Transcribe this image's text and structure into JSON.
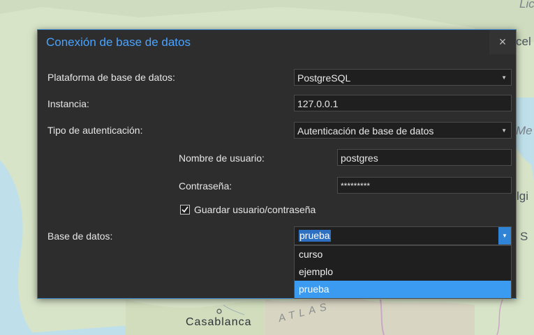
{
  "map": {
    "labels": {
      "top_right": "Lic",
      "right_1": "cel",
      "right_2": "Me",
      "right_3": "lgi",
      "right_4": "S",
      "city": "Casablanca",
      "range": "ATLAS"
    }
  },
  "dialog": {
    "title": "Conexión de base de datos",
    "close_icon": "×",
    "platform": {
      "label": "Plataforma de base de datos:",
      "value": "PostgreSQL"
    },
    "instance": {
      "label": "Instancia:",
      "value": "127.0.0.1"
    },
    "auth_type": {
      "label": "Tipo de autenticación:",
      "value": "Autenticación de base de datos"
    },
    "username": {
      "label": "Nombre de usuario:",
      "value": "postgres"
    },
    "password": {
      "label": "Contraseña:",
      "value": "*********"
    },
    "save_credentials": {
      "label": "Guardar usuario/contraseña",
      "checked": true
    },
    "database": {
      "label": "Base de datos:",
      "value": "prueba",
      "options": [
        "curso",
        "ejemplo",
        "prueba"
      ],
      "selected_index": 2
    }
  },
  "colors": {
    "accent": "#2f84d6",
    "title": "#4aa3ff",
    "dialog_bg": "#2d2d2d",
    "field_bg": "#1f1f1f",
    "selected_option": "#3a9bf0"
  },
  "icons": {
    "close": "close-icon",
    "dropdown": "chevron-down-icon",
    "check": "check-icon"
  }
}
